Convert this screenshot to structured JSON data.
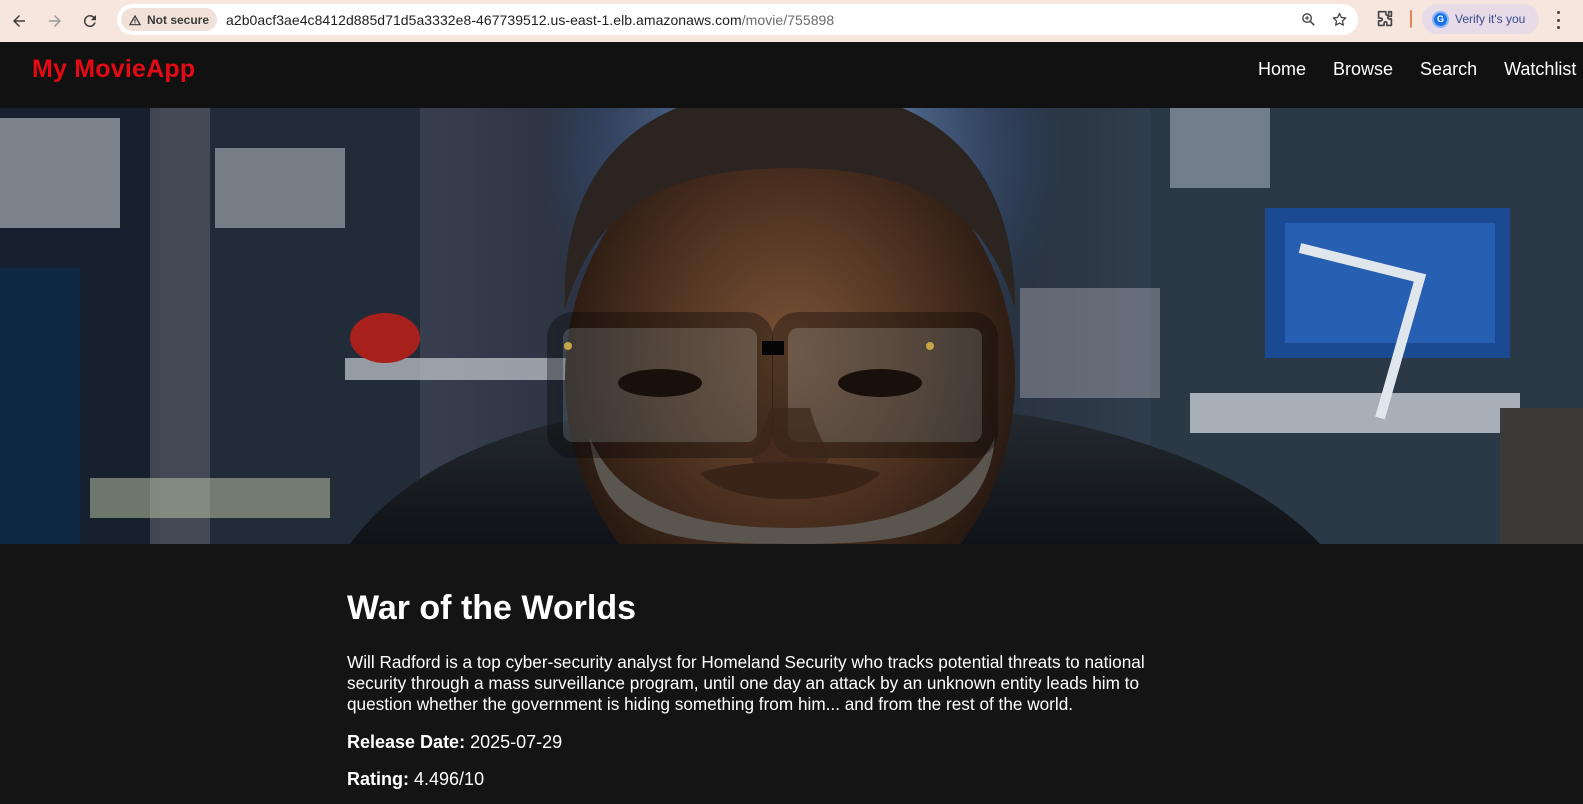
{
  "browser": {
    "security_label": "Not secure",
    "url_host": "a2b0acf3ae4c8412d885d71d5a3332e8-467739512.us-east-1.elb.amazonaws.com",
    "url_path": "/movie/755898",
    "verify_label": "Verify it's you",
    "avatar_letter": "G"
  },
  "header": {
    "brand": "My MovieApp",
    "nav": [
      "Home",
      "Browse",
      "Search",
      "Watchlist"
    ]
  },
  "movie": {
    "title": "War of the Worlds",
    "overview": "Will Radford is a top cyber-security analyst for Homeland Security who tracks potential threats to national security through a mass surveillance program, until one day an attack by an unknown entity leads him to question whether the government is hiding something from him... and from the rest of the world.",
    "release_label": "Release Date:",
    "release_date": "2025-07-29",
    "rating_label": "Rating:",
    "rating": "4.496/10"
  },
  "colors": {
    "brand": "#e50914",
    "page_bg": "#141414",
    "header_bg": "#111111"
  }
}
